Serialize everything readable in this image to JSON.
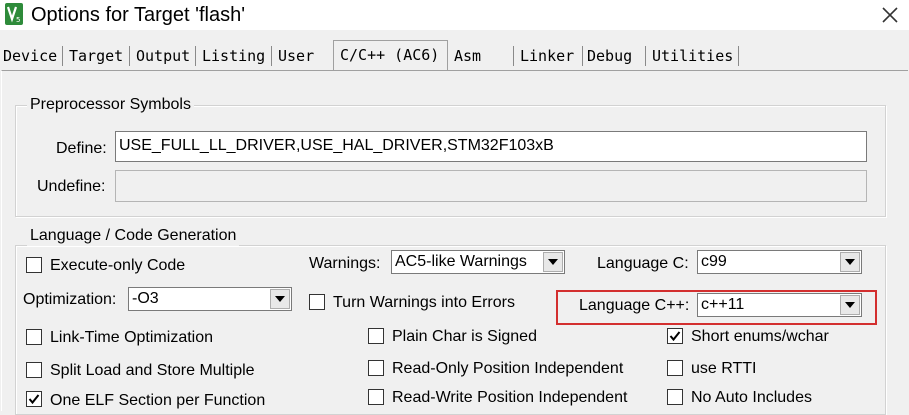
{
  "window": {
    "title": "Options for Target 'flash'"
  },
  "tabs": [
    {
      "label": "Device"
    },
    {
      "label": "Target"
    },
    {
      "label": "Output"
    },
    {
      "label": "Listing"
    },
    {
      "label": "User"
    },
    {
      "label": "C/C++ (AC6)",
      "active": true
    },
    {
      "label": "Asm"
    },
    {
      "label": "Linker"
    },
    {
      "label": "Debug"
    },
    {
      "label": "Utilities"
    }
  ],
  "preprocessor": {
    "legend": "Preprocessor Symbols",
    "define_label": "Define:",
    "define_value": "USE_FULL_LL_DRIVER,USE_HAL_DRIVER,STM32F103xB",
    "undefine_label": "Undefine:",
    "undefine_value": ""
  },
  "codegen": {
    "legend": "Language / Code Generation",
    "execute_only": {
      "label": "Execute-only Code",
      "checked": false
    },
    "warnings": {
      "label": "Warnings:",
      "value": "AC5-like Warnings"
    },
    "language_c": {
      "label": "Language C:",
      "value": "c99"
    },
    "optimization": {
      "label": "Optimization:",
      "value": "-O3"
    },
    "turn_warnings": {
      "label": "Turn Warnings into Errors",
      "checked": false
    },
    "language_cpp": {
      "label": "Language C++:",
      "value": "c++11"
    },
    "link_time": {
      "label": "Link-Time Optimization",
      "checked": false
    },
    "plain_char": {
      "label": "Plain Char is Signed",
      "checked": false
    },
    "short_enums": {
      "label": "Short enums/wchar",
      "checked": true
    },
    "split_load": {
      "label": "Split Load and Store Multiple",
      "checked": false
    },
    "ro_pi": {
      "label": "Read-Only Position Independent",
      "checked": false
    },
    "use_rtti": {
      "label": "use RTTI",
      "checked": false
    },
    "one_elf": {
      "label": "One ELF Section per Function",
      "checked": true
    },
    "rw_pi": {
      "label": "Read-Write Position Independent",
      "checked": false
    },
    "no_auto": {
      "label": "No Auto Includes",
      "checked": false
    }
  },
  "colors": {
    "highlight": "#d32f2f"
  }
}
